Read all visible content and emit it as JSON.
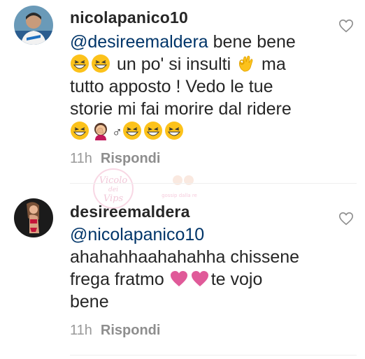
{
  "comments": [
    {
      "username": "nicolapanico10",
      "mention": "@desireemaldera",
      "line1_rest": " bene bene",
      "line2_text": " un po' si insulti ",
      "line2_tail": " ma",
      "line3": "tutto apposto ! Vedo le tue",
      "line4": "storie mi fai morire dal ridere",
      "line5_symbol": "♂",
      "time": "11h",
      "reply": "Rispondi"
    },
    {
      "username": "desireemaldera",
      "mention": "@nicolapanico10",
      "line1": "ahahahhaahahahha chissene",
      "line2_text": "frega fratmo ",
      "line2_tail": "te vojo",
      "line3": "bene",
      "time": "11h",
      "reply": "Rispondi"
    }
  ],
  "watermark": {
    "line1": "Vicolo",
    "line2": "dei",
    "line3": "Vips",
    "tagline": "gossip dalla rete"
  },
  "colors": {
    "text": "#262626",
    "mention": "#003569",
    "meta": "#999999",
    "heart_pink": "#e05a99"
  }
}
